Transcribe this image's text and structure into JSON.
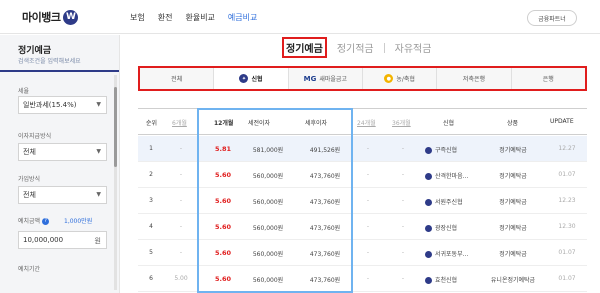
{
  "header": {
    "logo_text": "마이뱅크",
    "logo_badge": "W",
    "nav": [
      "보험",
      "환전",
      "환율비교",
      "예금비교"
    ],
    "active_nav": 3,
    "partner_button": "금융파트너"
  },
  "sidebar": {
    "title": "정기예금",
    "subtitle": "검색조건을 입력해보세요",
    "tax_label": "세율",
    "tax_value": "일반과세(15.4%)",
    "interest_label": "이자지급방식",
    "interest_value": "전체",
    "join_label": "가입방식",
    "join_value": "전체",
    "amount_label": "예치금액",
    "amount_link": "1,000만원",
    "amount_value": "10,000,000",
    "amount_unit": "원",
    "period_label": "예치기간"
  },
  "main_tabs": [
    "정기예금",
    "정기적금",
    "자유적금"
  ],
  "categories": [
    {
      "label": "전체",
      "icon": ""
    },
    {
      "label": "신협",
      "icon": "shinhyup-icon"
    },
    {
      "label": "새마을금고",
      "icon": "mg-icon"
    },
    {
      "label": "농/축협",
      "icon": "nh-icon"
    },
    {
      "label": "저축은행",
      "icon": ""
    },
    {
      "label": "은행",
      "icon": ""
    }
  ],
  "table": {
    "headers": [
      "순위",
      "6개월",
      "12개월",
      "세전이자",
      "세후이자",
      "24개월",
      "36개월",
      "신협",
      "상품",
      "UPDATE"
    ],
    "rows": [
      {
        "rank": "1",
        "m6": "-",
        "m12": "5.81",
        "pre": "581,000원",
        "post": "491,526원",
        "m24": "-",
        "m36": "-",
        "bank": "구즉신협",
        "product": "정기예탁금",
        "update": "12.27"
      },
      {
        "rank": "2",
        "m6": "-",
        "m12": "5.60",
        "pre": "560,000원",
        "post": "473,760원",
        "m24": "-",
        "m36": "-",
        "bank": "산격한마음...",
        "product": "정기예탁금",
        "update": "01.07"
      },
      {
        "rank": "3",
        "m6": "-",
        "m12": "5.60",
        "pre": "560,000원",
        "post": "473,760원",
        "m24": "-",
        "m36": "-",
        "bank": "서원주신협",
        "product": "정기예탁금",
        "update": "12.23"
      },
      {
        "rank": "4",
        "m6": "-",
        "m12": "5.60",
        "pre": "560,000원",
        "post": "473,760원",
        "m24": "-",
        "m36": "-",
        "bank": "광장신협",
        "product": "정기예탁금",
        "update": "12.30"
      },
      {
        "rank": "5",
        "m6": "-",
        "m12": "5.60",
        "pre": "560,000원",
        "post": "473,760원",
        "m24": "-",
        "m36": "-",
        "bank": "서귀포동부...",
        "product": "정기예탁금",
        "update": "01.07"
      },
      {
        "rank": "6",
        "m6": "5.00",
        "m12": "5.60",
        "pre": "560,000원",
        "post": "473,760원",
        "m24": "-",
        "m36": "-",
        "bank": "효천신협",
        "product": "유니온정기예탁금",
        "update": "01.07"
      }
    ]
  },
  "colors": {
    "accent": "#2f6fdc",
    "rate": "#e01d1d",
    "highlight": "#e01d1d",
    "column_box": "#6fb3f0"
  }
}
